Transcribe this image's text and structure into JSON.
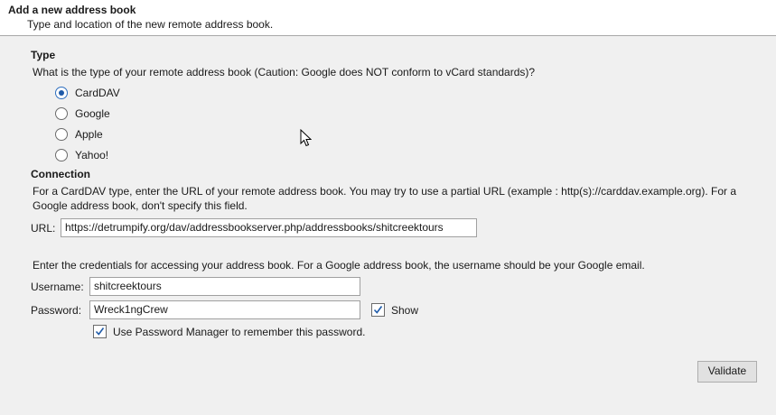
{
  "header": {
    "title": "Add a new address book",
    "subtitle": "Type and location of the new remote address book."
  },
  "type_section": {
    "title": "Type",
    "question": "What is the type of your remote address book (Caution: Google does NOT conform to vCard standards)?",
    "options": [
      {
        "label": "CardDAV",
        "checked": true
      },
      {
        "label": "Google",
        "checked": false
      },
      {
        "label": "Apple",
        "checked": false
      },
      {
        "label": "Yahoo!",
        "checked": false
      }
    ]
  },
  "connection": {
    "title": "Connection",
    "description": "For a CardDAV type, enter the URL of your remote address book. You may try to use a partial URL (example : http(s)://carddav.example.org). For a Google address book, don't specify this field.",
    "url_label": "URL:",
    "url_value": "https://detrumpify.org/dav/addressbookserver.php/addressbooks/shitcreektours"
  },
  "credentials": {
    "description": "Enter the credentials for accessing your address book. For a Google address book, the username should be your Google email.",
    "username_label": "Username:",
    "username_value": "shitcreektours",
    "password_label": "Password:",
    "password_value": "Wreck1ngCrew",
    "show_label": "Show",
    "show_checked": true,
    "password_manager_label": "Use Password Manager to remember this password.",
    "password_manager_checked": true
  },
  "buttons": {
    "validate_label": "Validate"
  },
  "colors": {
    "radio_accent": "#1e5aa8",
    "checkmark": "#1e5aa8",
    "background": "#f0f0f0"
  }
}
